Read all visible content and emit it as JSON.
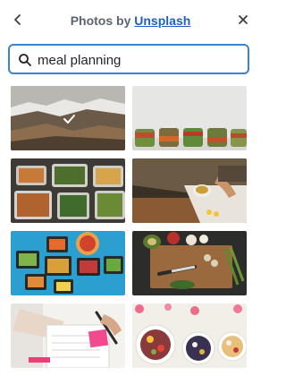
{
  "header": {
    "title_prefix": "Photos by",
    "title_link": "Unsplash",
    "back_icon": "chevron-left-icon",
    "close_icon": "close-icon"
  },
  "search": {
    "value": "meal planning",
    "icon": "search-icon"
  },
  "photos": [
    {
      "subject": "mountain landscape with snow"
    },
    {
      "subject": "meal prep jars of salad"
    },
    {
      "subject": "meal prep containers with vegetables"
    },
    {
      "subject": "person writing in planner with coffee"
    },
    {
      "subject": "colorful meal prep boxes and pizza"
    },
    {
      "subject": "cutting board with vegetables"
    },
    {
      "subject": "person writing in notebook"
    },
    {
      "subject": "bowls of fruit and acai"
    }
  ],
  "colors": {
    "accent": "#3b82d6",
    "link": "#1f5fbf",
    "title": "#5b6470"
  }
}
